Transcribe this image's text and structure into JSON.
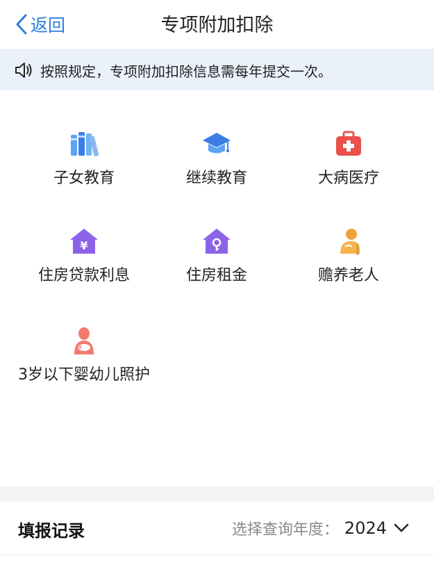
{
  "nav": {
    "back_label": "返回",
    "title": "专项附加扣除"
  },
  "notice": {
    "text": "按照规定，专项附加扣除信息需每年提交一次。"
  },
  "items": [
    {
      "label": "子女教育",
      "icon": "books-icon"
    },
    {
      "label": "继续教育",
      "icon": "graduation-cap-icon"
    },
    {
      "label": "大病医疗",
      "icon": "medical-kit-icon"
    },
    {
      "label": "住房贷款利息",
      "icon": "house-yuan-icon"
    },
    {
      "label": "住房租金",
      "icon": "house-key-icon"
    },
    {
      "label": "赡养老人",
      "icon": "elderly-person-icon"
    },
    {
      "label": "3岁以下婴幼儿照护",
      "icon": "mother-baby-icon"
    }
  ],
  "records": {
    "title": "填报记录",
    "year_label": "选择查询年度：",
    "year_value": "2024"
  },
  "colors": {
    "accent": "#2a7de1",
    "notice_bg": "#eaf1fb"
  }
}
